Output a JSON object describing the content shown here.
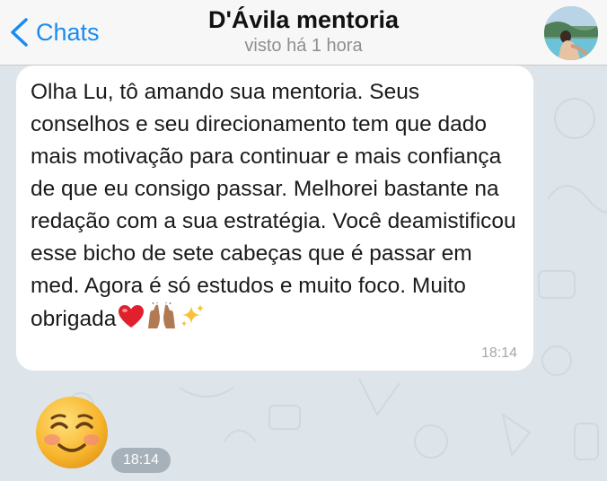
{
  "header": {
    "back_label": "Chats",
    "title": "D'Ávila mentoria",
    "subtitle": "visto há 1 hora",
    "avatar_icon": "profile-photo"
  },
  "messages": [
    {
      "text": "Olha Lu, tô amando sua mentoria. Seus conselhos e seu direcionamento tem que dado mais motivação para continuar e mais confiança de que eu consigo passar. Melhorei bastante na redação com a sua estratégia. Você deamistificou esse bicho de sete cabeças que é passar em med. Agora é só estudos e muito foco. Muito obrigada",
      "emojis": [
        "red-heart-emoji",
        "raising-hands-emoji",
        "sparkles-emoji"
      ],
      "time": "18:14"
    },
    {
      "sticker": "smiling-face-emoji",
      "time": "18:14"
    }
  ],
  "colors": {
    "accent": "#1a8cf0",
    "chat_background": "#dde5eb",
    "bubble": "#ffffff"
  }
}
